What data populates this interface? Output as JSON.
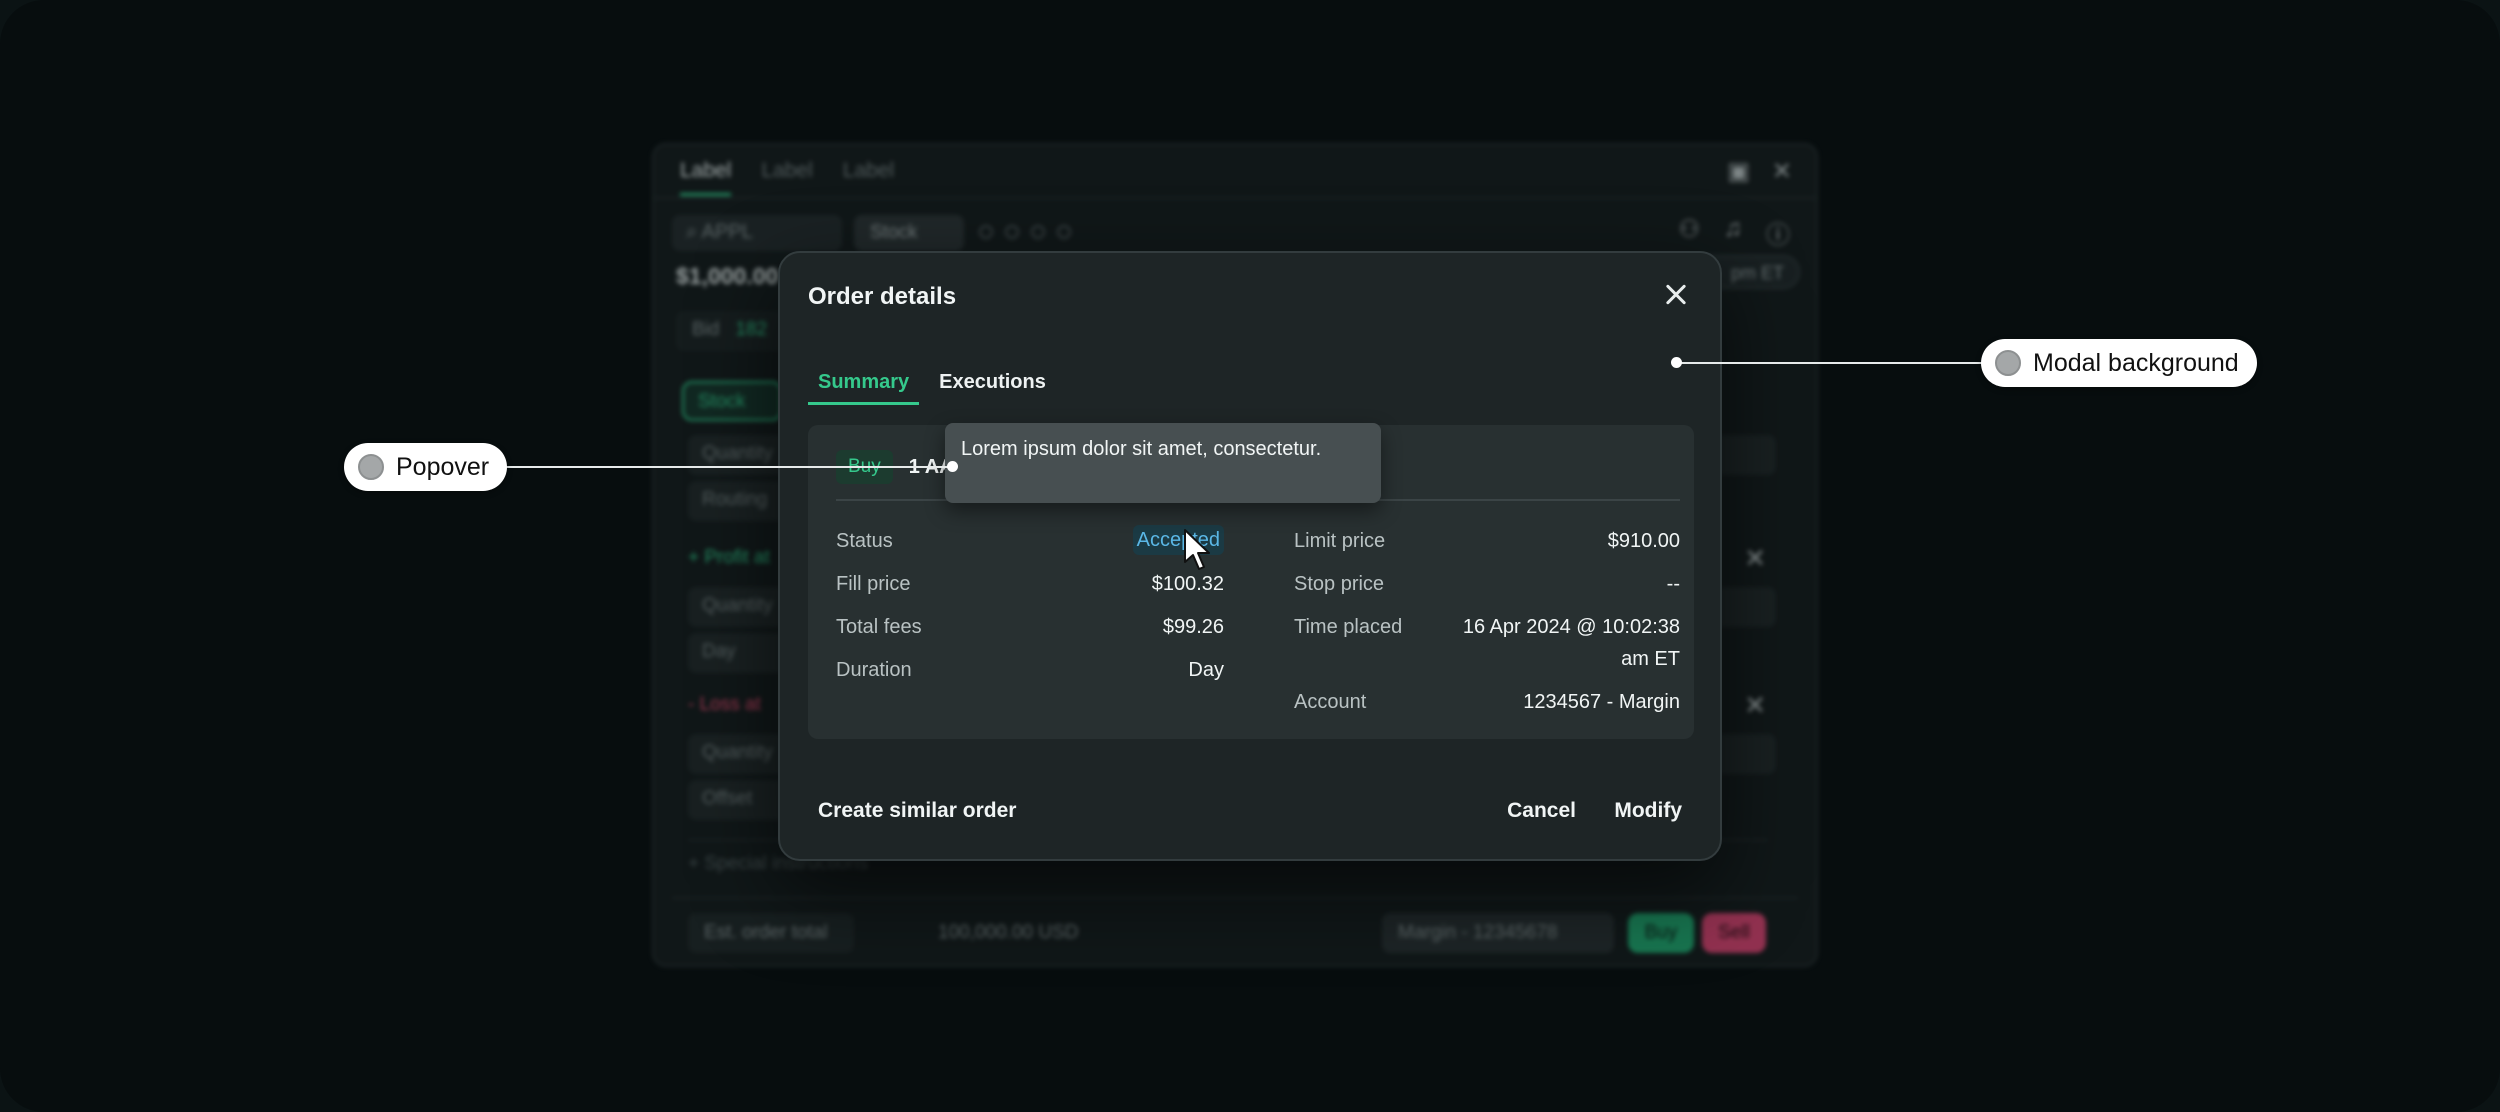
{
  "background_window": {
    "tabs": [
      "Label",
      "Label",
      "Label"
    ],
    "search_value": "APPL",
    "instrument_chip": "Stock",
    "price": "$1,000.00",
    "session_pill": "pm ET",
    "bid_label": "Bid",
    "bid_value": "182",
    "stock_pill": "Stock",
    "quantity_label": "Quantity",
    "routing_label": "Routing",
    "profit_label": "+ Profit at",
    "day_label": "Day",
    "loss_label": "- Loss at",
    "offset_label": "Offset",
    "special_label": "+ Special instructions",
    "est_label": "Est. order total",
    "est_value": "100,000.00 USD",
    "account_select": "Margin - 12345678",
    "buy_button": "Buy",
    "sell_button": "Sell"
  },
  "modal": {
    "title": "Order details",
    "tabs": [
      {
        "label": "Summary",
        "active": true
      },
      {
        "label": "Executions",
        "active": false
      }
    ],
    "order": {
      "side": "Buy",
      "quantity_text": "1 AA"
    },
    "left_rows": [
      {
        "label": "Status",
        "value": "Accepted"
      },
      {
        "label": "Fill price",
        "value": "$100.32"
      },
      {
        "label": "Total fees",
        "value": "$99.26"
      },
      {
        "label": "Duration",
        "value": "Day"
      }
    ],
    "right_rows": [
      {
        "label": "Limit price",
        "value": "$910.00"
      },
      {
        "label": "Stop price",
        "value": "--"
      },
      {
        "label": "Time placed",
        "value": "16 Apr 2024 @ 10:02:38 am ET"
      },
      {
        "label": "Account",
        "value": "1234567 - Margin"
      }
    ],
    "footer": {
      "create_similar": "Create similar order",
      "cancel": "Cancel",
      "modify": "Modify"
    }
  },
  "popover": {
    "text": "Lorem ipsum dolor sit amet, consectetur."
  },
  "annotations": {
    "popover_label": "Popover",
    "modal_background_label": "Modal background"
  },
  "colors": {
    "accent_green": "#35c98c",
    "status_blue": "#5ab7e6",
    "sell_pink": "#c8406a",
    "modal_bg": "#1e2526"
  }
}
